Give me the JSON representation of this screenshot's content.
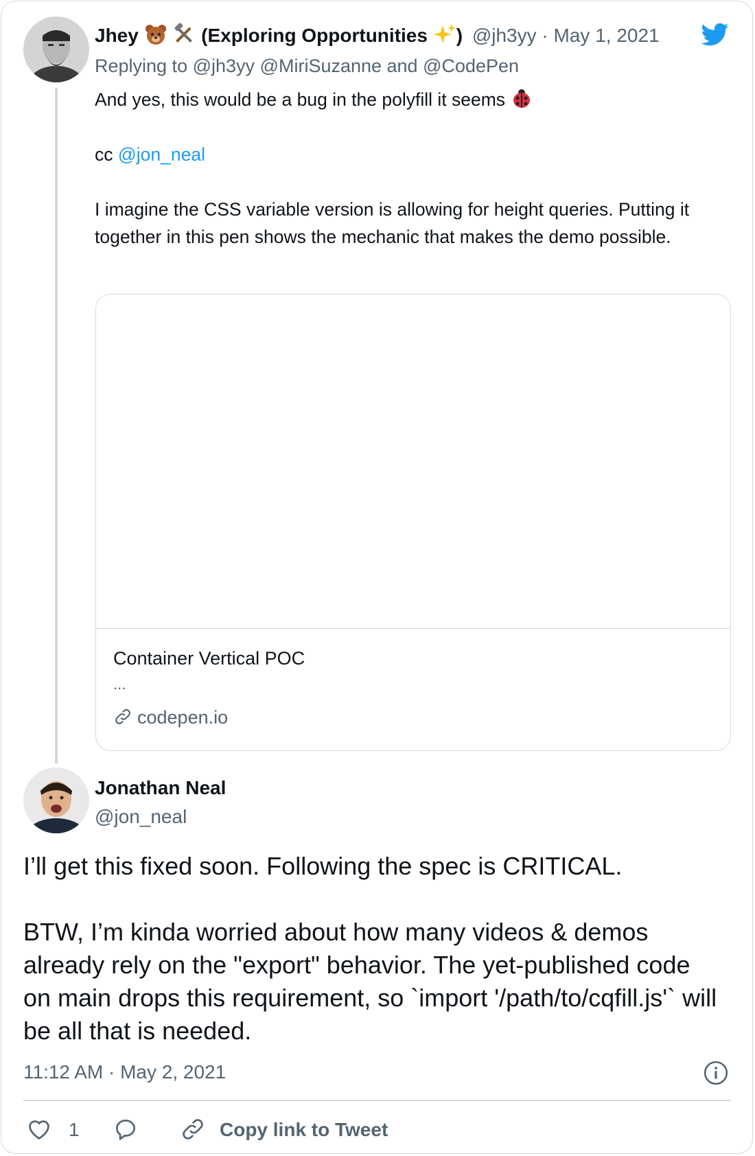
{
  "brand": {
    "accent": "#1d9bf0",
    "muted": "#536471",
    "border": "#cfd9de"
  },
  "parent_tweet": {
    "author_name": "Jhey",
    "author_name_suffix": "(Exploring Opportunities",
    "author_name_close": ")",
    "handle": "@jh3yy",
    "separator": "·",
    "date": "May 1, 2021",
    "replying_prefix": "Replying to",
    "replying_to": "@jh3yy @MiriSuzanne and @CodePen",
    "line1": "And yes, this would be a bug in the polyfill it seems",
    "cc_prefix": "cc",
    "cc_mention": "@jon_neal",
    "paragraph": "I imagine the CSS variable version is allowing for height queries. Putting it together in this pen shows the mechanic that makes the demo possible.",
    "card": {
      "title": "Container Vertical POC",
      "description": "...",
      "domain": "codepen.io"
    }
  },
  "main_tweet": {
    "author_name": "Jonathan Neal",
    "handle": "@jon_neal",
    "para1": "I’ll get this fixed soon. Following the spec is CRITICAL.",
    "para2": "BTW, I’m kinda worried about how many videos & demos already rely on the \"export\" behavior. The yet-published code on main drops this requirement, so `import '/path/to/cqfill.js'` will be all that is needed.",
    "timestamp": "11:12 AM · May 2, 2021"
  },
  "actions": {
    "like_count": "1",
    "copy_link_label": "Copy link to Tweet"
  },
  "icons": {
    "logo": "twitter-bird-icon",
    "info": "info-icon",
    "like": "heart-icon",
    "reply": "reply-bubble-icon",
    "link": "link-icon"
  }
}
